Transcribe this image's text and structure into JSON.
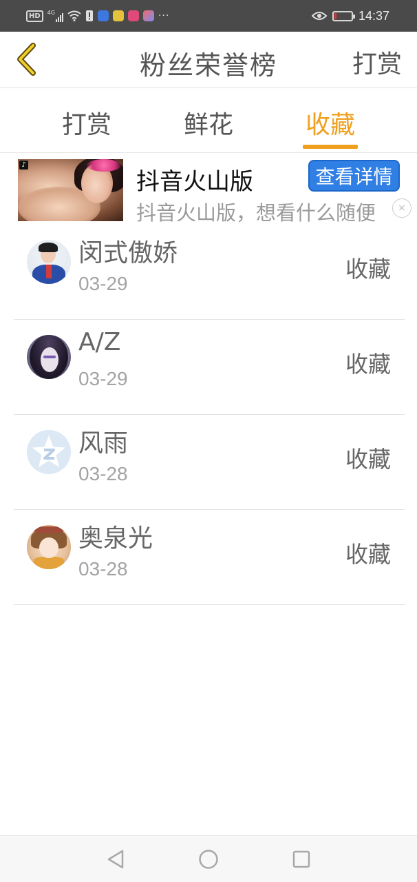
{
  "status_bar": {
    "hd_label": "HD",
    "network_label": "4G",
    "time": "14:37",
    "battery_level": 0.12,
    "overflow_dots": "···"
  },
  "header": {
    "title": "粉丝荣誉榜",
    "right_action": "打赏",
    "back_icon": "chevron-left-icon"
  },
  "tabs": [
    {
      "label": "打赏",
      "active": false
    },
    {
      "label": "鲜花",
      "active": false
    },
    {
      "label": "收藏",
      "active": true
    }
  ],
  "ad": {
    "title": "抖音火山版",
    "description": "抖音火山版，想看什么随便",
    "button_label": "查看详情",
    "close_glyph": "×",
    "badge_icon": "tiktok-icon"
  },
  "list": [
    {
      "name": "闵式傲娇",
      "date": "03-29",
      "action": "收藏"
    },
    {
      "name": "A/Z",
      "date": "03-29",
      "action": "收藏"
    },
    {
      "name": "风雨",
      "date": "03-28",
      "action": "收藏"
    },
    {
      "name": "奥泉光",
      "date": "03-28",
      "action": "收藏"
    }
  ],
  "colors": {
    "accent": "#f0a01e",
    "ad_button": "#2f7fe5",
    "status_bar": "#4a4a4a"
  },
  "nav": {
    "back_icon": "triangle-back-icon",
    "home_icon": "circle-home-icon",
    "recent_icon": "square-recents-icon"
  }
}
